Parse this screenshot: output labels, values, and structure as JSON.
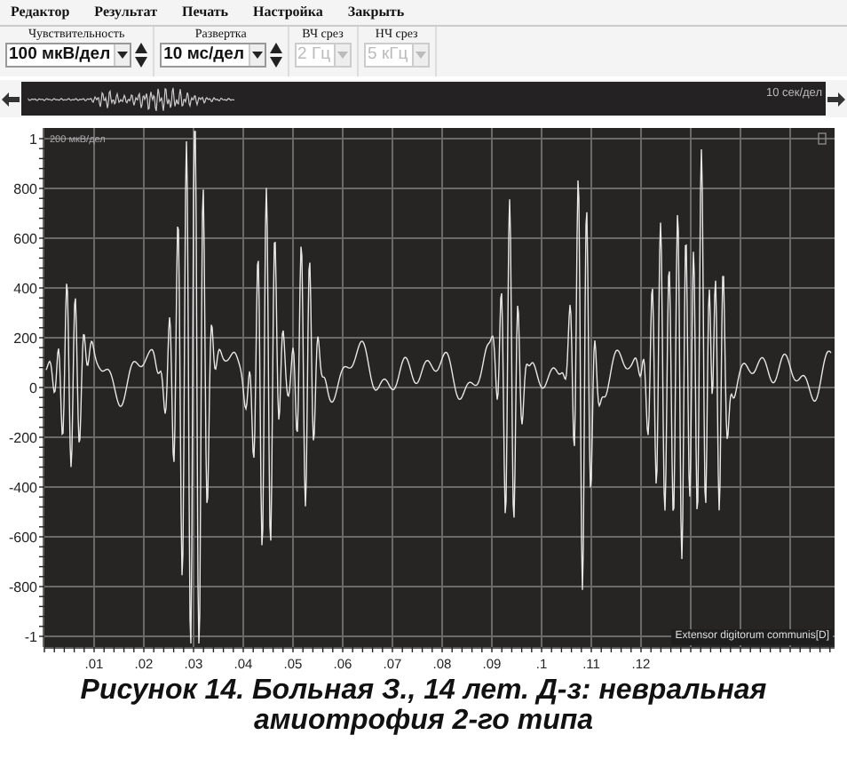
{
  "menu": [
    {
      "label": "Редактор"
    },
    {
      "label": "Результат"
    },
    {
      "label": "Печать"
    },
    {
      "label": "Настройка"
    },
    {
      "label": "Закрыть"
    }
  ],
  "toolbar": [
    {
      "label": "Чувствительность",
      "value": "100 мкВ/дел",
      "disabled": false,
      "spinner": true
    },
    {
      "label": "Развертка",
      "value": "10 мс/дел",
      "disabled": false,
      "spinner": true
    },
    {
      "label": "ВЧ срез",
      "value": "2 Гц",
      "disabled": true,
      "spinner": false
    },
    {
      "label": "НЧ срез",
      "value": "5 кГц",
      "disabled": true,
      "spinner": false
    }
  ],
  "overview": {
    "scale_label": "10 сек/дел"
  },
  "plot": {
    "scale_label": "200 мкВ/дел",
    "y_tick_labels": [
      "1",
      "800",
      "600",
      "400",
      "200",
      "0",
      "-200",
      "-400",
      "-600",
      "-800",
      "-1"
    ],
    "x_tick_labels": [
      ".01",
      ".02",
      ".03",
      ".04",
      ".05",
      ".06",
      ".07",
      ".08",
      ".09",
      ".1",
      ".11",
      ".12"
    ],
    "channel_label": "Extensor digitorum communis[D]"
  },
  "caption": "Рисунок 14. Больная З., 14 лет. Д-з: невральная амиотрофия 2-го типа"
}
